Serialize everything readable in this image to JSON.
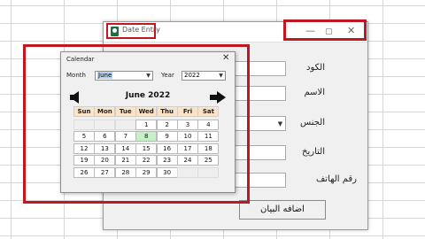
{
  "main_window": {
    "title": "Date Entry",
    "controls": {
      "minimize": "—",
      "maximize": "▢",
      "close": "✕"
    },
    "fields": [
      {
        "label": "الكود"
      },
      {
        "label": "الاسم"
      },
      {
        "label": "الجنس"
      },
      {
        "label": "التاريخ"
      },
      {
        "label": "رقم الهاتف"
      }
    ],
    "add_button": "اضافه البيان"
  },
  "calendar": {
    "title": "Calendar",
    "close": "✕",
    "month_label": "Month",
    "month_value": "June",
    "year_label": "Year",
    "year_value": "2022",
    "header": "June 2022",
    "weekdays": [
      "Sun",
      "Mon",
      "Tue",
      "Wed",
      "Thu",
      "Fri",
      "Sat"
    ],
    "weeks": [
      [
        "",
        "",
        "",
        "1",
        "2",
        "3",
        "4"
      ],
      [
        "5",
        "6",
        "7",
        "8",
        "9",
        "10",
        "11"
      ],
      [
        "12",
        "13",
        "14",
        "15",
        "16",
        "17",
        "18"
      ],
      [
        "19",
        "20",
        "21",
        "22",
        "23",
        "24",
        "25"
      ],
      [
        "26",
        "27",
        "28",
        "29",
        "30",
        "",
        ""
      ]
    ],
    "selected_day": "8",
    "selected_color": "#c8f0c8",
    "header_color": "#fbe3c8"
  },
  "highlight_color": "#c01822"
}
